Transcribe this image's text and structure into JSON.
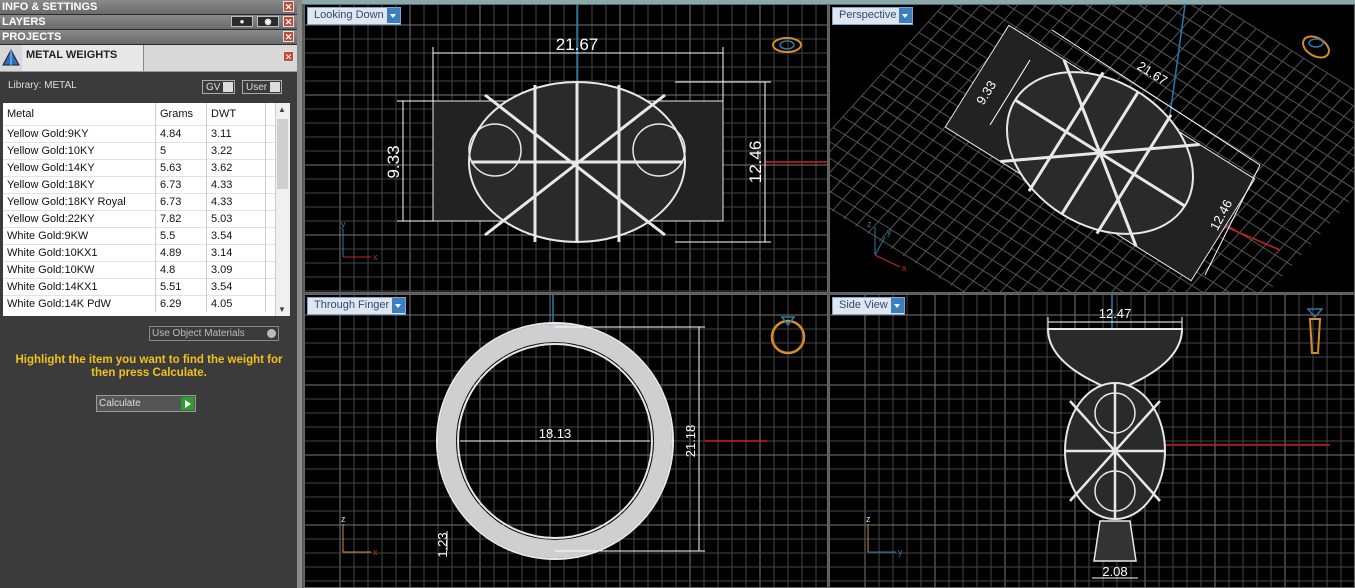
{
  "sections": {
    "info": "INFO & SETTINGS",
    "layers": "LAYERS",
    "projects": "PROJECTS",
    "metal_weights": "METAL WEIGHTS"
  },
  "library": {
    "label": "Library: METAL",
    "gv": "GV",
    "user": "User"
  },
  "table": {
    "headers": [
      "Metal",
      "Grams",
      "DWT"
    ],
    "rows": [
      [
        "Yellow Gold:9KY",
        "4.84",
        "3.11"
      ],
      [
        "Yellow Gold:10KY",
        "5",
        "3.22"
      ],
      [
        "Yellow Gold:14KY",
        "5.63",
        "3.62"
      ],
      [
        "Yellow Gold:18KY",
        "6.73",
        "4.33"
      ],
      [
        "Yellow Gold:18KY Royal",
        "6.73",
        "4.33"
      ],
      [
        "Yellow Gold:22KY",
        "7.82",
        "5.03"
      ],
      [
        "White Gold:9KW",
        "5.5",
        "3.54"
      ],
      [
        "White Gold:10KX1",
        "4.89",
        "3.14"
      ],
      [
        "White Gold:10KW",
        "4.8",
        "3.09"
      ],
      [
        "White Gold:14KX1",
        "5.51",
        "3.54"
      ],
      [
        "White Gold:14K PdW",
        "6.29",
        "4.05"
      ]
    ]
  },
  "use_object_materials": "Use Object Materials",
  "hint": "Highlight the item you want to find the weight for then press Calculate.",
  "calculate": "Calculate",
  "viewports": {
    "top_left": {
      "title": "Looking Down",
      "dims": [
        "21.67",
        "9.33",
        "12.46"
      ]
    },
    "top_right": {
      "title": "Perspective",
      "dims": [
        "21.67",
        "9.33",
        "12.46"
      ]
    },
    "bottom_left": {
      "title": "Through Finger",
      "dims": [
        "18.13",
        "21.18",
        "1.23"
      ]
    },
    "bottom_right": {
      "title": "Side View",
      "dims": [
        "12.47",
        "2.08"
      ]
    }
  },
  "axes": {
    "x": "x",
    "y": "y",
    "z": "z"
  },
  "colors": {
    "accent_gold": "#f2c21a",
    "wire": "#e8e8e8",
    "grid": "#555555",
    "axis_red": "#cc2222",
    "axis_blue": "#2a7aa8"
  }
}
